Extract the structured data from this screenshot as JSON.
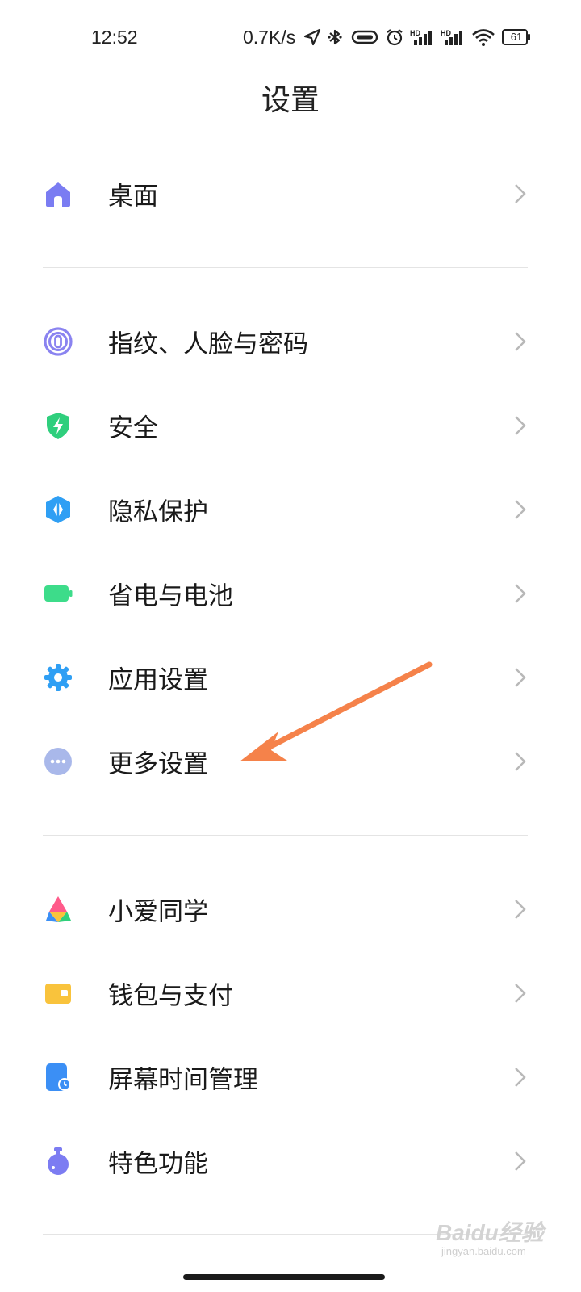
{
  "status_bar": {
    "time": "12:52",
    "net_speed": "0.7K/s",
    "hd_label_1": "HD",
    "hd_label_2": "HD",
    "battery_level": "61",
    "icons": [
      "location-icon",
      "bluetooth-icon",
      "capsule-icon",
      "alarm-icon",
      "signal-icon",
      "signal-icon",
      "wifi-icon",
      "battery-icon"
    ]
  },
  "page_title": "设置",
  "groups": [
    {
      "items": [
        {
          "label": "桌面",
          "icon": "home-icon",
          "color": "#7a7cf2"
        }
      ]
    },
    {
      "items": [
        {
          "label": "指纹、人脸与密码",
          "icon": "fingerprint-icon",
          "color": "#8a83f0"
        },
        {
          "label": "安全",
          "icon": "security-shield-icon",
          "color": "#2fcf7d"
        },
        {
          "label": "隐私保护",
          "icon": "privacy-icon",
          "color": "#2f9ff4"
        },
        {
          "label": "省电与电池",
          "icon": "battery-saver-icon",
          "color": "#3ddc8a"
        },
        {
          "label": "应用设置",
          "icon": "app-settings-gear-icon",
          "color": "#2f9ff4"
        },
        {
          "label": "更多设置",
          "icon": "more-dots-icon",
          "color": "#a9b8ea"
        }
      ]
    },
    {
      "items": [
        {
          "label": "小爱同学",
          "icon": "xiaoai-icon",
          "color": "#5b8cf5"
        },
        {
          "label": "钱包与支付",
          "icon": "wallet-icon",
          "color": "#f9c33c"
        },
        {
          "label": "屏幕时间管理",
          "icon": "screen-time-icon",
          "color": "#3b8ff5"
        },
        {
          "label": "特色功能",
          "icon": "special-features-icon",
          "color": "#7c7cf2"
        }
      ]
    }
  ],
  "annotation": {
    "arrow_color": "#f5824a"
  },
  "watermark": {
    "text": "Baidu经验",
    "sub": "jingyan.baidu.com"
  }
}
